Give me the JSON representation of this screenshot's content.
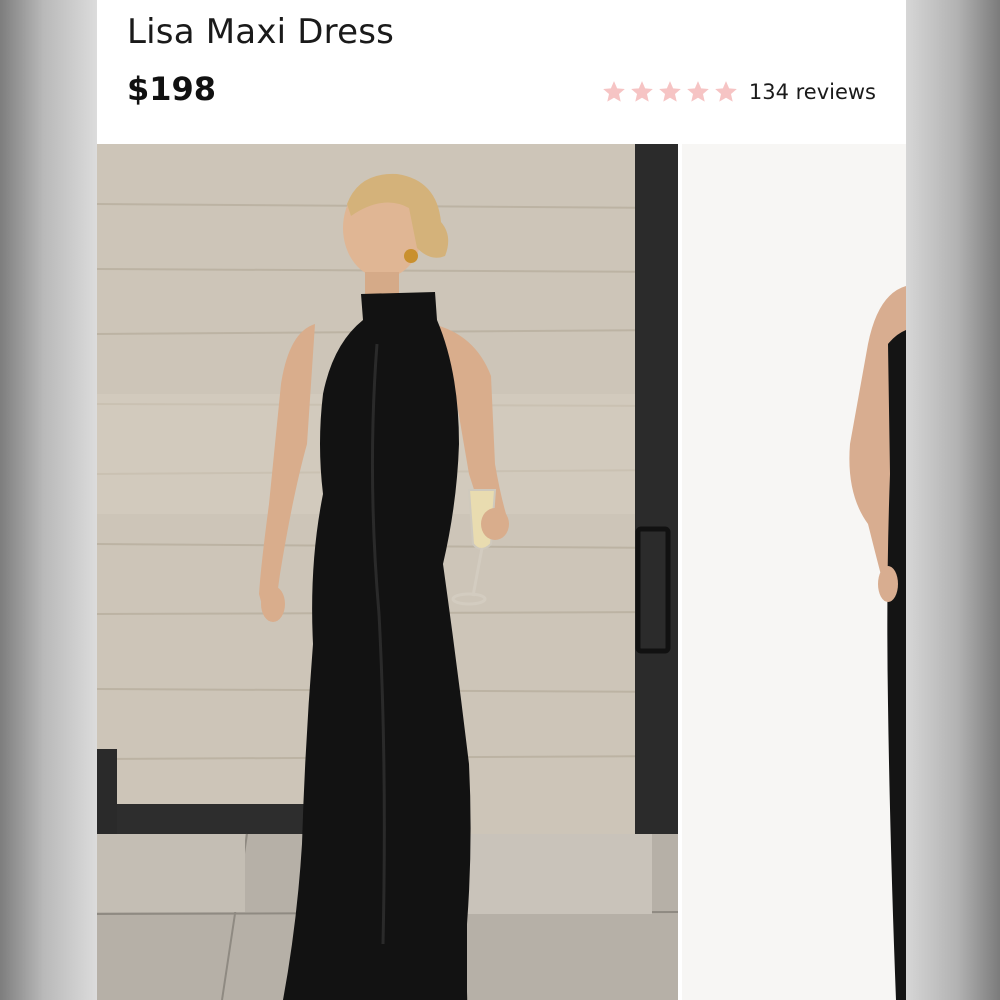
{
  "product": {
    "title": "Lisa Maxi Dress",
    "price": "$198",
    "rating": {
      "stars": 5,
      "star_color": "#f6c4c4",
      "reviews_label": "134 reviews"
    }
  },
  "gallery": {
    "images": [
      {
        "name": "model-photo-black-halter-dress"
      },
      {
        "name": "studio-photo-black-dress-side"
      }
    ]
  }
}
